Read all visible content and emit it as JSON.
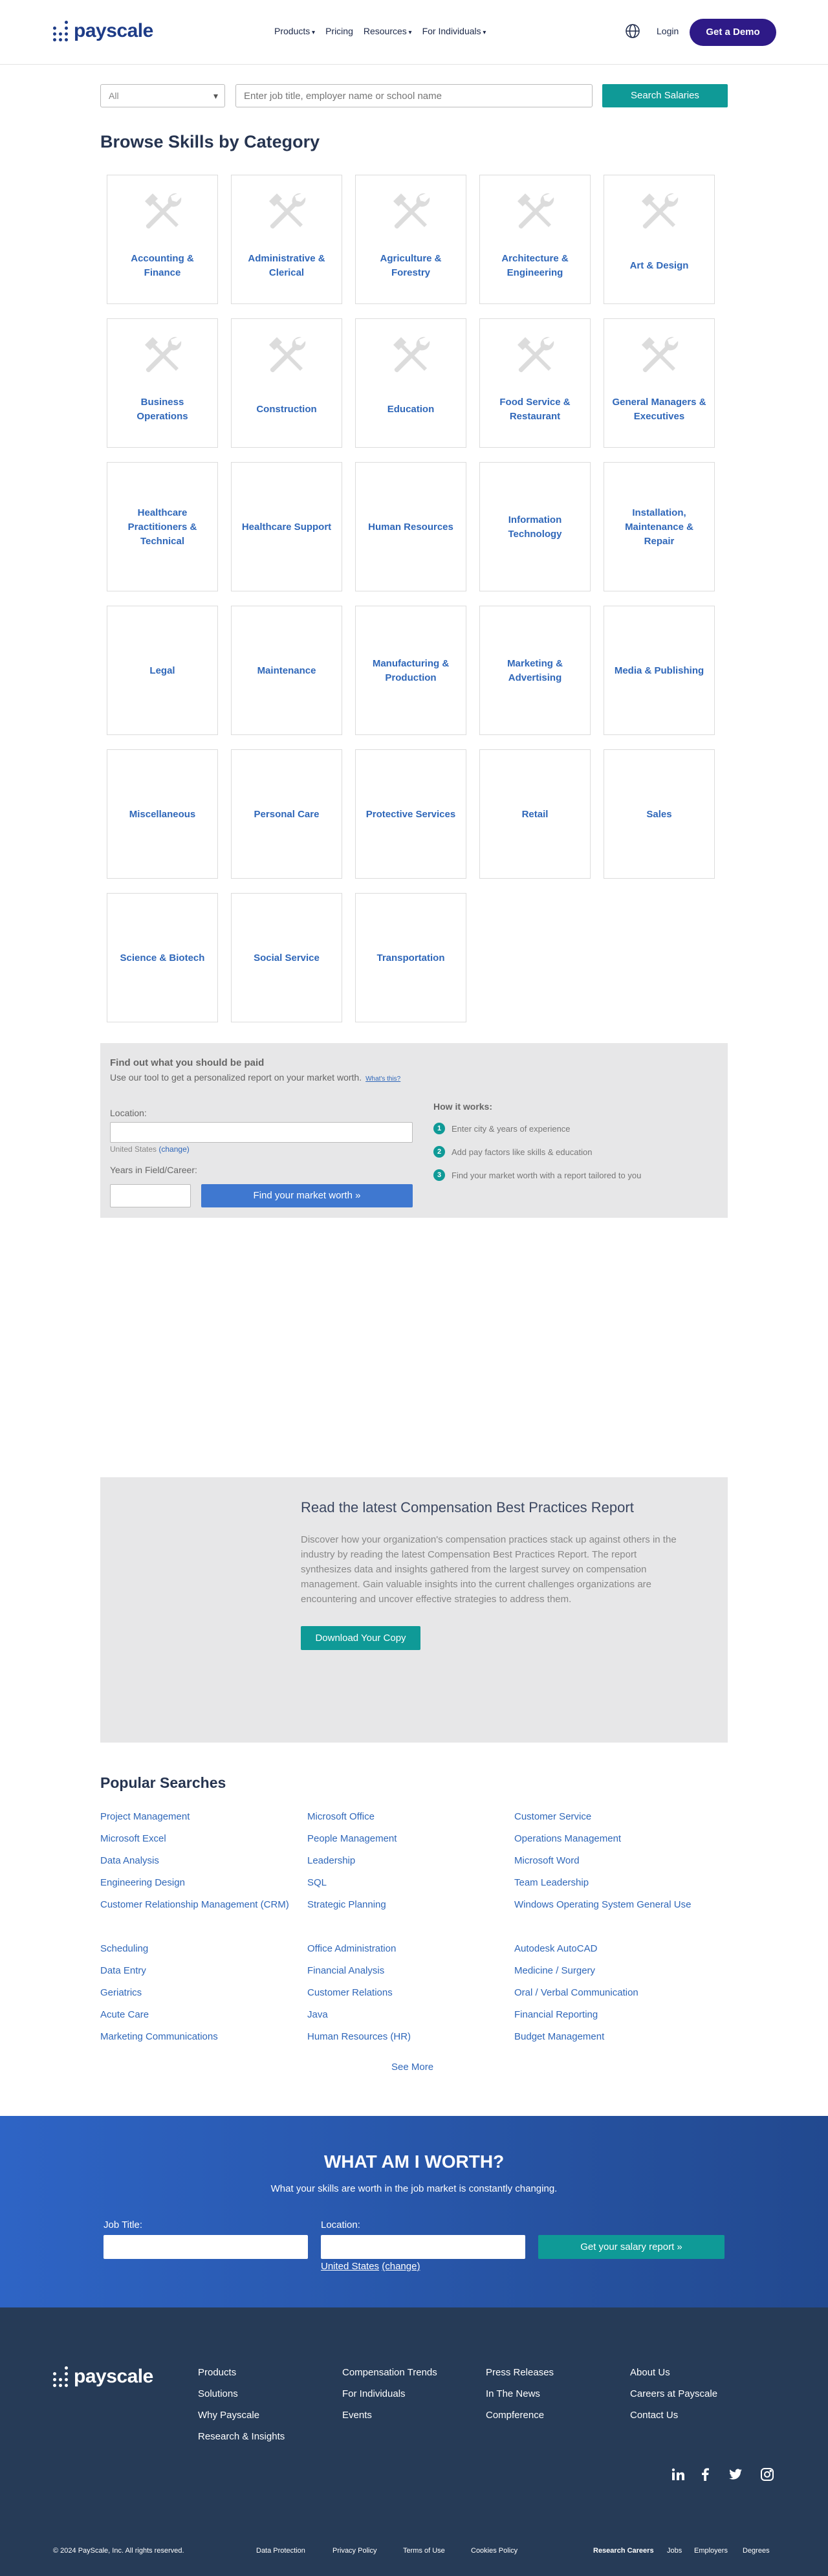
{
  "header": {
    "brand": "payscale",
    "nav": [
      "Products",
      "Pricing",
      "Resources",
      "For Individuals"
    ],
    "login": "Login",
    "demo": "Get a Demo"
  },
  "search": {
    "filter_value": "All",
    "placeholder": "Enter job title, employer name or school name",
    "button": "Search Salaries"
  },
  "browse": {
    "title": "Browse Skills by Category",
    "categories": [
      "Accounting & Finance",
      "Administrative & Clerical",
      "Agriculture & Forestry",
      "Architecture & Engineering",
      "Art & Design",
      "Business Operations",
      "Construction",
      "Education",
      "Food Service & Restaurant",
      "General Managers & Executives",
      "Healthcare Practitioners & Technical",
      "Healthcare Support",
      "Human Resources",
      "Information Technology",
      "Installation, Maintenance & Repair",
      "Legal",
      "Maintenance",
      "Manufacturing & Production",
      "Marketing & Advertising",
      "Media & Publishing",
      "Miscellaneous",
      "Personal Care",
      "Protective Services",
      "Retail",
      "Sales",
      "Science & Biotech",
      "Social Service",
      "Transportation"
    ]
  },
  "worth_tool": {
    "title": "Find out what you should be paid",
    "subtitle": "Use our tool to get a personalized report on your market worth.",
    "whats_this": "What's this?",
    "location_label": "Location:",
    "country": "United States",
    "change": "(change)",
    "years_label": "Years in Field/Career:",
    "button": "Find your market worth »",
    "how_title": "How it works:",
    "steps": [
      "Enter city & years of experience",
      "Add pay factors like skills & education",
      "Find your market worth with a report tailored to you"
    ]
  },
  "report": {
    "title": "Read the latest Compensation Best Practices Report",
    "body": "Discover how your organization's compensation practices stack up against others in the industry by reading the latest Compensation Best Practices Report. The report synthesizes data and insights gathered from the largest survey on compensation management. Gain valuable insights into the current challenges organizations are encountering and uncover effective strategies to address them.",
    "button": "Download Your Copy"
  },
  "popular": {
    "title": "Popular Searches",
    "items": [
      "Project Management",
      "Microsoft Office",
      "Customer Service",
      "Microsoft Excel",
      "People Management",
      "Operations Management",
      "Data Analysis",
      "Leadership",
      "Microsoft Word",
      "Engineering Design",
      "SQL",
      "Team Leadership",
      "Customer Relationship Management (CRM)",
      "Strategic Planning",
      "Windows Operating System General Use",
      "Scheduling",
      "Office Administration",
      "Autodesk AutoCAD",
      "Data Entry",
      "Financial Analysis",
      "Medicine / Surgery",
      "Geriatrics",
      "Customer Relations",
      "Oral / Verbal Communication",
      "Acute Care",
      "Java",
      "Financial Reporting",
      "Marketing Communications",
      "Human Resources (HR)",
      "Budget Management"
    ],
    "see_more": "See More"
  },
  "worth_banner": {
    "title": "WHAT AM I WORTH?",
    "subtitle": "What your skills are worth in the job market is constantly changing.",
    "job_label": "Job Title:",
    "location_label": "Location:",
    "country": "United States",
    "change": "(change)",
    "button": "Get your salary report »"
  },
  "footer": {
    "brand": "payscale",
    "col1": [
      "Products",
      "Solutions",
      "Why Payscale",
      "Research & Insights"
    ],
    "col2": [
      "Compensation Trends",
      "For Individuals",
      "Events"
    ],
    "col3": [
      "Press Releases",
      "In The News",
      "Compference"
    ],
    "col4": [
      "About Us",
      "Careers at Payscale",
      "Contact Us"
    ],
    "copyright": "© 2024 PayScale, Inc. All rights reserved.",
    "legal": [
      "Data Protection",
      "Privacy Policy",
      "Terms of Use",
      "Cookies Policy"
    ],
    "research": "Research Careers",
    "bottom_links": [
      "Jobs",
      "Employers",
      "Degrees"
    ]
  }
}
